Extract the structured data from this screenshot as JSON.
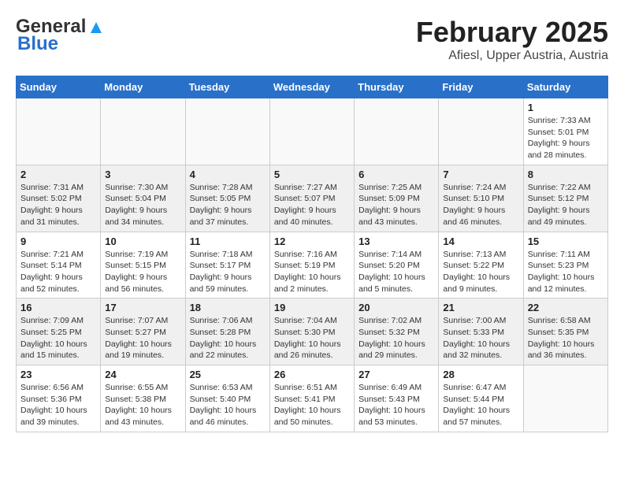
{
  "logo": {
    "line1": "General",
    "line2": "Blue"
  },
  "title": "February 2025",
  "subtitle": "Afiesl, Upper Austria, Austria",
  "weekdays": [
    "Sunday",
    "Monday",
    "Tuesday",
    "Wednesday",
    "Thursday",
    "Friday",
    "Saturday"
  ],
  "weeks": [
    [
      {
        "day": "",
        "info": ""
      },
      {
        "day": "",
        "info": ""
      },
      {
        "day": "",
        "info": ""
      },
      {
        "day": "",
        "info": ""
      },
      {
        "day": "",
        "info": ""
      },
      {
        "day": "",
        "info": ""
      },
      {
        "day": "1",
        "info": "Sunrise: 7:33 AM\nSunset: 5:01 PM\nDaylight: 9 hours and 28 minutes."
      }
    ],
    [
      {
        "day": "2",
        "info": "Sunrise: 7:31 AM\nSunset: 5:02 PM\nDaylight: 9 hours and 31 minutes."
      },
      {
        "day": "3",
        "info": "Sunrise: 7:30 AM\nSunset: 5:04 PM\nDaylight: 9 hours and 34 minutes."
      },
      {
        "day": "4",
        "info": "Sunrise: 7:28 AM\nSunset: 5:05 PM\nDaylight: 9 hours and 37 minutes."
      },
      {
        "day": "5",
        "info": "Sunrise: 7:27 AM\nSunset: 5:07 PM\nDaylight: 9 hours and 40 minutes."
      },
      {
        "day": "6",
        "info": "Sunrise: 7:25 AM\nSunset: 5:09 PM\nDaylight: 9 hours and 43 minutes."
      },
      {
        "day": "7",
        "info": "Sunrise: 7:24 AM\nSunset: 5:10 PM\nDaylight: 9 hours and 46 minutes."
      },
      {
        "day": "8",
        "info": "Sunrise: 7:22 AM\nSunset: 5:12 PM\nDaylight: 9 hours and 49 minutes."
      }
    ],
    [
      {
        "day": "9",
        "info": "Sunrise: 7:21 AM\nSunset: 5:14 PM\nDaylight: 9 hours and 52 minutes."
      },
      {
        "day": "10",
        "info": "Sunrise: 7:19 AM\nSunset: 5:15 PM\nDaylight: 9 hours and 56 minutes."
      },
      {
        "day": "11",
        "info": "Sunrise: 7:18 AM\nSunset: 5:17 PM\nDaylight: 9 hours and 59 minutes."
      },
      {
        "day": "12",
        "info": "Sunrise: 7:16 AM\nSunset: 5:19 PM\nDaylight: 10 hours and 2 minutes."
      },
      {
        "day": "13",
        "info": "Sunrise: 7:14 AM\nSunset: 5:20 PM\nDaylight: 10 hours and 5 minutes."
      },
      {
        "day": "14",
        "info": "Sunrise: 7:13 AM\nSunset: 5:22 PM\nDaylight: 10 hours and 9 minutes."
      },
      {
        "day": "15",
        "info": "Sunrise: 7:11 AM\nSunset: 5:23 PM\nDaylight: 10 hours and 12 minutes."
      }
    ],
    [
      {
        "day": "16",
        "info": "Sunrise: 7:09 AM\nSunset: 5:25 PM\nDaylight: 10 hours and 15 minutes."
      },
      {
        "day": "17",
        "info": "Sunrise: 7:07 AM\nSunset: 5:27 PM\nDaylight: 10 hours and 19 minutes."
      },
      {
        "day": "18",
        "info": "Sunrise: 7:06 AM\nSunset: 5:28 PM\nDaylight: 10 hours and 22 minutes."
      },
      {
        "day": "19",
        "info": "Sunrise: 7:04 AM\nSunset: 5:30 PM\nDaylight: 10 hours and 26 minutes."
      },
      {
        "day": "20",
        "info": "Sunrise: 7:02 AM\nSunset: 5:32 PM\nDaylight: 10 hours and 29 minutes."
      },
      {
        "day": "21",
        "info": "Sunrise: 7:00 AM\nSunset: 5:33 PM\nDaylight: 10 hours and 32 minutes."
      },
      {
        "day": "22",
        "info": "Sunrise: 6:58 AM\nSunset: 5:35 PM\nDaylight: 10 hours and 36 minutes."
      }
    ],
    [
      {
        "day": "23",
        "info": "Sunrise: 6:56 AM\nSunset: 5:36 PM\nDaylight: 10 hours and 39 minutes."
      },
      {
        "day": "24",
        "info": "Sunrise: 6:55 AM\nSunset: 5:38 PM\nDaylight: 10 hours and 43 minutes."
      },
      {
        "day": "25",
        "info": "Sunrise: 6:53 AM\nSunset: 5:40 PM\nDaylight: 10 hours and 46 minutes."
      },
      {
        "day": "26",
        "info": "Sunrise: 6:51 AM\nSunset: 5:41 PM\nDaylight: 10 hours and 50 minutes."
      },
      {
        "day": "27",
        "info": "Sunrise: 6:49 AM\nSunset: 5:43 PM\nDaylight: 10 hours and 53 minutes."
      },
      {
        "day": "28",
        "info": "Sunrise: 6:47 AM\nSunset: 5:44 PM\nDaylight: 10 hours and 57 minutes."
      },
      {
        "day": "",
        "info": ""
      }
    ]
  ]
}
